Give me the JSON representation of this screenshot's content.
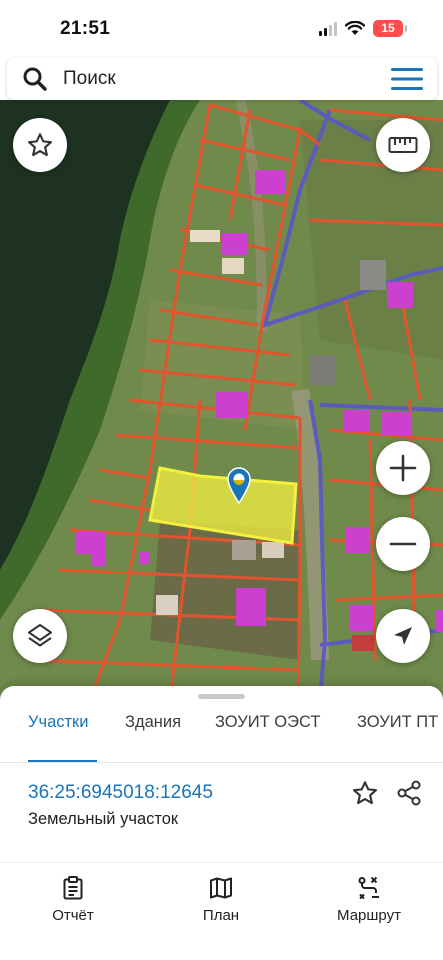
{
  "status_bar": {
    "time": "21:51",
    "battery": "15"
  },
  "search": {
    "placeholder": "Поиск"
  },
  "map": {
    "favorites_icon": "star-outline-icon",
    "ruler_icon": "ruler-icon",
    "layers_icon": "layers-icon",
    "zoom_in_icon": "plus-icon",
    "zoom_out_icon": "minus-icon",
    "locate_icon": "navigation-arrow-icon",
    "highlight_color": "#f3f040",
    "boundary_color": "#e2542d",
    "road_color": "#5a57c9"
  },
  "tabs": [
    {
      "label": "Участки",
      "active": true
    },
    {
      "label": "Здания",
      "active": false
    },
    {
      "label": "ЗОУИТ ОЭСТ",
      "active": false
    },
    {
      "label": "ЗОУИТ ПТ",
      "active": false
    }
  ],
  "parcel": {
    "cadastral_number": "36:25:6945018:12645",
    "type": "Земельный участок"
  },
  "bottom_nav": {
    "report": "Отчёт",
    "plan": "План",
    "route": "Маршрут"
  },
  "colors": {
    "accent": "#1a74b8"
  }
}
